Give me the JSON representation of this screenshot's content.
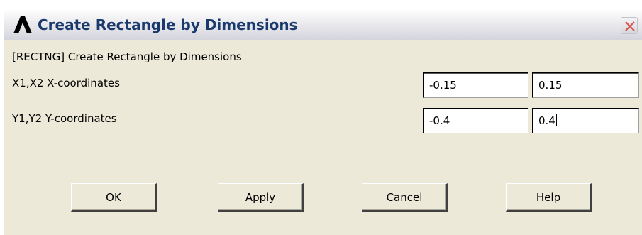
{
  "window": {
    "title": "Create Rectangle by Dimensions",
    "app_icon": "ansys-logo-icon",
    "close_icon": "close-icon"
  },
  "form": {
    "command_label": "[RECTNG]  Create Rectangle by Dimensions",
    "rows": [
      {
        "label": "X1,X2  X-coordinates",
        "value1": "-0.15",
        "value2": "0.15"
      },
      {
        "label": "Y1,Y2  Y-coordinates",
        "value1": "-0.4",
        "value2": "0.4"
      }
    ]
  },
  "buttons": {
    "ok": "OK",
    "apply": "Apply",
    "cancel": "Cancel",
    "help": "Help"
  },
  "colors": {
    "title_text": "#1a3a6e",
    "dialog_bg": "#ece9d8",
    "close_x": "#d9534f"
  }
}
